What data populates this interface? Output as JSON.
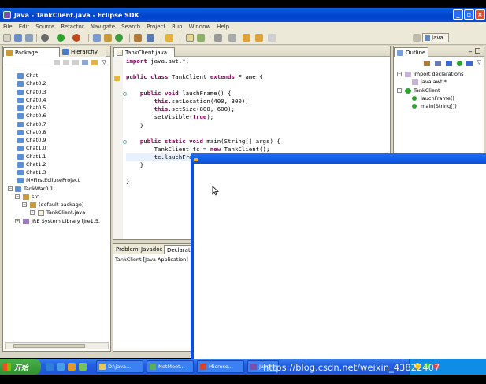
{
  "window": {
    "title": "Java - TankClient.java - Eclipse SDK"
  },
  "menu": [
    "File",
    "Edit",
    "Source",
    "Refactor",
    "Navigate",
    "Search",
    "Project",
    "Run",
    "Window",
    "Help"
  ],
  "perspective": {
    "label": "Java"
  },
  "package_explorer": {
    "tabs": [
      "Package...",
      "Hierarchy"
    ],
    "items": [
      "Chat",
      "Chat0.2",
      "Chat0.3",
      "Chat0.4",
      "Chat0.5",
      "Chat0.6",
      "Chat0.7",
      "Chat0.8",
      "Chat0.9",
      "Chat1.0",
      "Chat1.1",
      "Chat1.2",
      "Chat1.3",
      "MyFirstEclipseProject",
      "TankWar0.1",
      "src",
      "(default package)",
      "TankClient.java",
      "JRE System Library [jre1.5."
    ]
  },
  "editor": {
    "tab": "TankClient.java",
    "lines": [
      "import java.awt.*;",
      "",
      "public class TankClient extends Frame {",
      "",
      "    public void lauchFrame() {",
      "        this.setLocation(400, 300);",
      "        this.setSize(800, 600);",
      "        setVisible(true);",
      "    }",
      "",
      "    public static void main(String[] args) {",
      "        TankClient tc = new TankClient();",
      "        tc.lauchFrame();",
      "    }",
      "",
      "}"
    ]
  },
  "bottom_views": {
    "tabs": [
      "Problems",
      "Javadoc",
      "Declarati"
    ],
    "console_text": "TankClient [Java Application]"
  },
  "outline": {
    "tab": "Outline",
    "items": [
      "import declarations",
      "java.awt.*",
      "TankClient",
      "lauchFrame()",
      "main(String[])"
    ]
  },
  "taskbar": {
    "start_label": "开始",
    "tasks": [
      "D:\\java...",
      "NetMeet...",
      "Microso...",
      "Java -..."
    ],
    "watermark": "https://blog.csdn.net/weixin_43822407"
  },
  "colors": {
    "titlebar": "#0042c8",
    "keyword": "#7f0055",
    "start": "#2e8f2e"
  }
}
